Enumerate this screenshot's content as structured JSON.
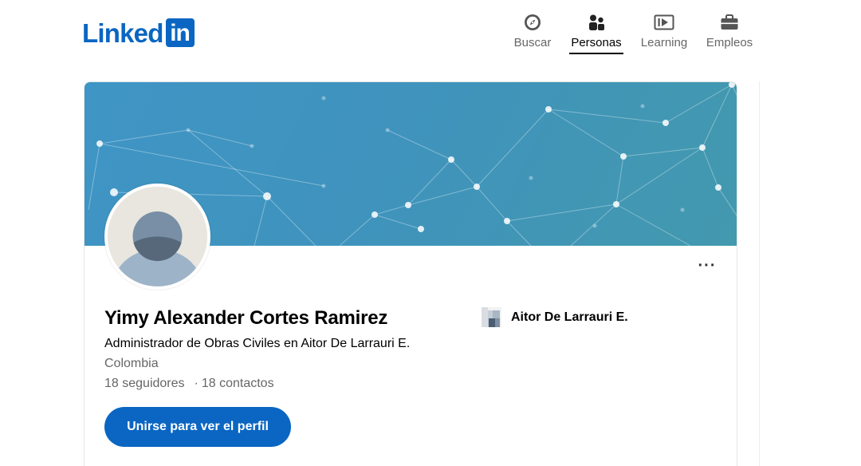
{
  "header": {
    "logo_text": "Linked",
    "logo_box_text": "in",
    "nav": [
      {
        "label": "Buscar",
        "icon": "compass-icon",
        "active": false
      },
      {
        "label": "Personas",
        "icon": "people-icon",
        "active": true
      },
      {
        "label": "Learning",
        "icon": "play-video-icon",
        "active": false
      },
      {
        "label": "Empleos",
        "icon": "briefcase-icon",
        "active": false
      }
    ]
  },
  "profile": {
    "name": "Yimy Alexander Cortes Ramirez",
    "headline": "Administrador de Obras Civiles en Aitor De Larrauri E.",
    "location": "Colombia",
    "followers": "18 seguidores",
    "separator": "·",
    "connections": "18 contactos",
    "more_label": "···",
    "company": {
      "name": "Aitor De Larrauri E.",
      "icon": "company-logo-icon"
    },
    "join_button": "Unirse para ver el perfil"
  },
  "colors": {
    "brand": "#0a66c2",
    "cover": "#4196c0",
    "text_secondary": "#666666"
  }
}
